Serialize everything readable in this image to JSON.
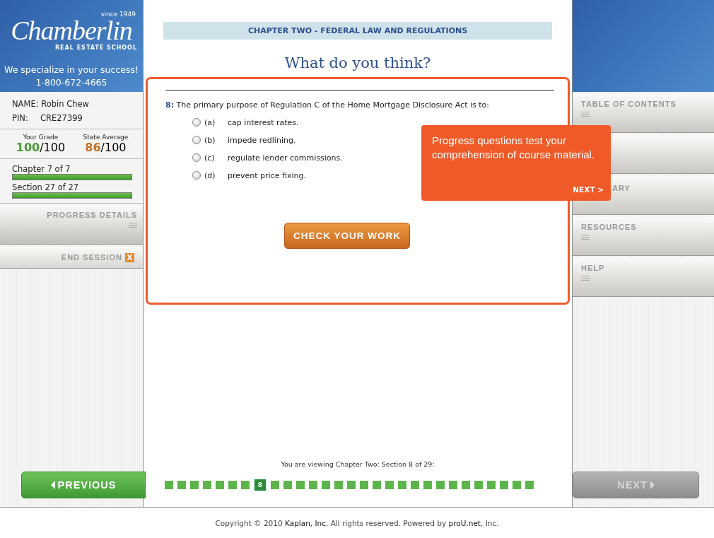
{
  "brand": {
    "since": "since 1949",
    "name": "Chamberlin",
    "subtitle": "REAL ESTATE SCHOOL",
    "slogan": "We specialize in your success!",
    "phone": "1-800-672-4665"
  },
  "student": {
    "name_label": "NAME:",
    "name": "Robin Chew",
    "pin_label": "PIN:",
    "pin": "CRE27399"
  },
  "grades": [
    {
      "label": "Your Grade",
      "score": "100",
      "total": "/100",
      "color": "#4c9a3c"
    },
    {
      "label": "State Average",
      "score": "86",
      "total": "/100",
      "color": "#c0712a"
    }
  ],
  "progress": [
    {
      "label": "Chapter 7 of 7",
      "level": 1
    },
    {
      "label": "Section 27 of 27",
      "level": 1
    }
  ],
  "left_menu": [
    {
      "kind": "panel",
      "label": "PROGRESS DETAILS"
    },
    {
      "kind": "action",
      "label": "END SESSION",
      "icon": "X"
    }
  ],
  "right_menu": [
    {
      "kind": "plain",
      "label": "TABLE OF CONTENTS"
    },
    {
      "kind": "blank"
    },
    {
      "kind": "clipped",
      "label": "ARY"
    },
    {
      "kind": "plain",
      "label": "RESOURCES"
    },
    {
      "kind": "plain",
      "label": "HELP"
    }
  ],
  "chapter_banner": "CHAPTER TWO - FEDERAL LAW AND REGULATIONS",
  "heading": "What do you think?",
  "question": {
    "number": "8:",
    "text": "The primary purpose of Regulation C of the Home Mortgage Disclosure Act is to:"
  },
  "options": [
    {
      "letter": "(a)",
      "text": "cap interest rates.",
      "selected": false
    },
    {
      "letter": "(b)",
      "text": "impede redlining.",
      "selected": false
    },
    {
      "letter": "(c)",
      "text": "regulate lender commissions.",
      "selected": false
    },
    {
      "letter": "(d)",
      "text": "prevent price fixing.",
      "selected": false
    }
  ],
  "check_button": "CHECK YOUR WORK",
  "tooltip": {
    "text": "Progress questions test your comprehension of course material.",
    "next": "NEXT >"
  },
  "viewing": "You are viewing Chapter Two: Section 8 of 29:",
  "previous_button": {
    "label": "PREVIOUS",
    "disabled": false
  },
  "next_button": {
    "label": "NEXT",
    "disabled": true
  },
  "sections": [
    {
      "selected": false
    },
    {
      "selected": false
    },
    {
      "selected": false
    },
    {
      "selected": false
    },
    {
      "selected": false
    },
    {
      "selected": false
    },
    {
      "selected": false
    },
    {
      "selected": true,
      "label": "8"
    },
    {
      "selected": false
    },
    {
      "selected": false
    },
    {
      "selected": false
    },
    {
      "selected": false
    },
    {
      "selected": false
    },
    {
      "selected": false
    },
    {
      "selected": false
    },
    {
      "selected": false
    },
    {
      "selected": false
    },
    {
      "selected": false
    },
    {
      "selected": false
    },
    {
      "selected": false
    },
    {
      "selected": false
    },
    {
      "selected": false
    },
    {
      "selected": false
    },
    {
      "selected": false
    },
    {
      "selected": false
    },
    {
      "selected": false
    },
    {
      "selected": false
    },
    {
      "selected": false
    },
    {
      "selected": false
    }
  ],
  "footer": {
    "parts": [
      {
        "kind": "text",
        "text": "Copyright © 2010 "
      },
      {
        "kind": "link",
        "text": "Kaplan, Inc."
      },
      {
        "kind": "text",
        "text": " All rights reserved. Powered by "
      },
      {
        "kind": "link",
        "text": "proU.net"
      },
      {
        "kind": "text",
        "text": ", Inc."
      }
    ]
  }
}
